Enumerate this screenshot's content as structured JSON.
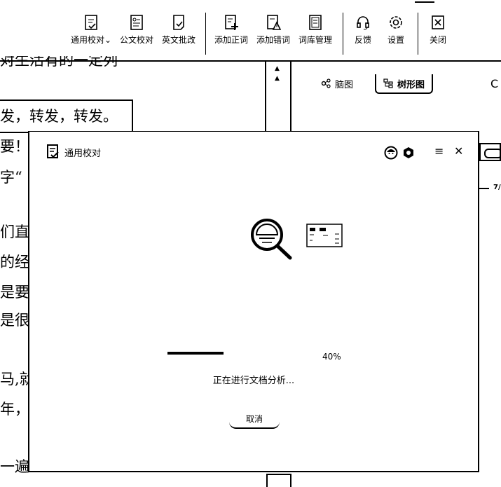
{
  "toolbar": {
    "items": [
      {
        "label": "通用校对",
        "icon": "proofread-check-icon",
        "has_dropdown": true
      },
      {
        "label": "公文校对",
        "icon": "official-doc-icon"
      },
      {
        "label": "英文批改",
        "icon": "english-correct-icon"
      },
      {
        "label": "添加正词",
        "icon": "add-word-icon"
      },
      {
        "label": "添加错词",
        "icon": "add-error-word-icon"
      },
      {
        "label": "词库管理",
        "icon": "dictionary-icon"
      },
      {
        "label": "反馈",
        "icon": "headset-icon"
      },
      {
        "label": "设置",
        "icon": "gear-icon"
      },
      {
        "label": "关闭",
        "icon": "close-box-icon"
      }
    ],
    "dropdown_glyph": "⌄"
  },
  "document": {
    "lines": [
      "发，转发，转发。",
      "要！",
      "字“",
      "们直",
      "的经",
      "是要",
      "是很",
      "马,就",
      "年，",
      "一遍"
    ],
    "top_fragment": "对生活有的一定列"
  },
  "mindmap": {
    "tabs": [
      {
        "label": "脑图",
        "icon": "mindmap-icon",
        "active": false
      },
      {
        "label": "树形图",
        "icon": "tree-icon",
        "active": true
      }
    ],
    "refresh_glyph": "C",
    "page_marker": "7/"
  },
  "dialog": {
    "title": "通用校对",
    "controls": {
      "menu_glyph": "≡",
      "close_glyph": "✕"
    },
    "progress": {
      "percent_label": "40%",
      "value": 0.4
    },
    "status": "正在进行文档分析...",
    "cancel_label": "取消"
  }
}
